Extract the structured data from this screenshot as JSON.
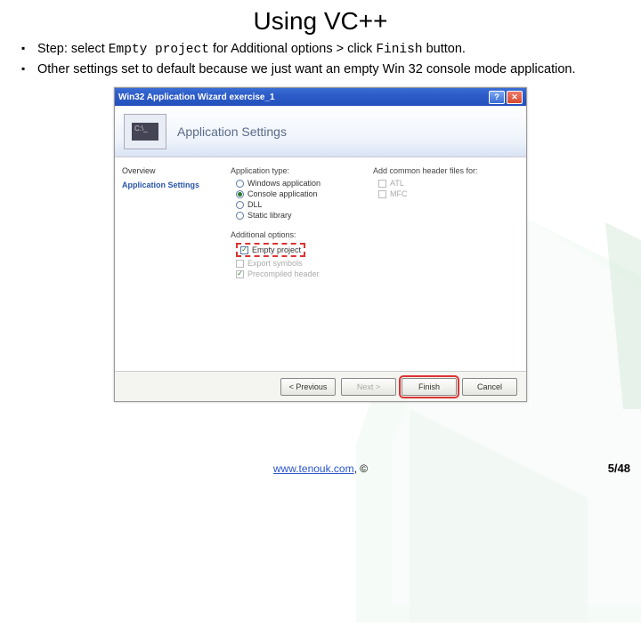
{
  "slide": {
    "title": "Using VC++",
    "bullets": [
      {
        "prefix": "Step: select ",
        "code1": "Empty project",
        "mid": " for Additional options > click ",
        "code2": "Finish",
        "suffix": " button."
      },
      {
        "text": "Other settings set to default because we just want an empty Win 32 console mode application."
      }
    ]
  },
  "wizard": {
    "titlebar": "Win32 Application Wizard   exercise_1",
    "help_glyph": "?",
    "close_glyph": "✕",
    "header_icon_text": "C:\\_",
    "header_title": "Application Settings",
    "nav": {
      "overview": "Overview",
      "settings": "Application Settings"
    },
    "left": {
      "app_type_label": "Application type:",
      "opt_windows": "Windows application",
      "opt_console": "Console application",
      "opt_dll": "DLL",
      "opt_static": "Static library",
      "add_opts_label": "Additional options:",
      "opt_empty": "Empty project",
      "opt_export": "Export symbols",
      "opt_precomp": "Precompiled header"
    },
    "right": {
      "common_hdr_label": "Add common header files for:",
      "opt_atl": "ATL",
      "opt_mfc": "MFC"
    },
    "buttons": {
      "prev": "< Previous",
      "next": "Next >",
      "finish": "Finish",
      "cancel": "Cancel"
    }
  },
  "footer": {
    "link": "www.tenouk.com",
    "copy": ", ©"
  },
  "page": "5/48"
}
